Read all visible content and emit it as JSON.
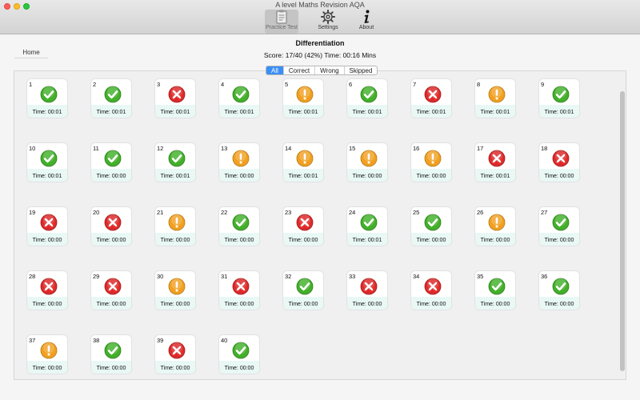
{
  "window": {
    "title": "A level Maths Revision AQA"
  },
  "toolbar": {
    "practice_label": "Practice Test",
    "settings_label": "Settings",
    "about_label": "About"
  },
  "nav": {
    "home_label": "Home"
  },
  "header": {
    "topic": "Differentiation",
    "score": "Score: 17/40 (42%) Time: 00:16 Mins"
  },
  "filters": [
    "All",
    "Correct",
    "Wrong",
    "Skipped"
  ],
  "filter_selected": "All",
  "colors": {
    "correct": "#43b02a",
    "wrong": "#e02a2a",
    "skipped": "#f0a020",
    "accent": "#3a8ff4"
  },
  "questions": [
    {
      "n": "1",
      "status": "correct",
      "time": "Time: 00:01"
    },
    {
      "n": "2",
      "status": "correct",
      "time": "Time: 00:01"
    },
    {
      "n": "3",
      "status": "wrong",
      "time": "Time: 00:01"
    },
    {
      "n": "4",
      "status": "correct",
      "time": "Time: 00:01"
    },
    {
      "n": "5",
      "status": "skipped",
      "time": "Time: 00:01"
    },
    {
      "n": "6",
      "status": "correct",
      "time": "Time: 00:01"
    },
    {
      "n": "7",
      "status": "wrong",
      "time": "Time: 00:01"
    },
    {
      "n": "8",
      "status": "skipped",
      "time": "Time: 00:01"
    },
    {
      "n": "9",
      "status": "correct",
      "time": "Time: 00:01"
    },
    {
      "n": "10",
      "status": "correct",
      "time": "Time: 00:01"
    },
    {
      "n": "11",
      "status": "correct",
      "time": "Time: 00:00"
    },
    {
      "n": "12",
      "status": "correct",
      "time": "Time: 00:01"
    },
    {
      "n": "13",
      "status": "skipped",
      "time": "Time: 00:00"
    },
    {
      "n": "14",
      "status": "skipped",
      "time": "Time: 00:01"
    },
    {
      "n": "15",
      "status": "skipped",
      "time": "Time: 00:00"
    },
    {
      "n": "16",
      "status": "skipped",
      "time": "Time: 00:00"
    },
    {
      "n": "17",
      "status": "wrong",
      "time": "Time: 00:01"
    },
    {
      "n": "18",
      "status": "wrong",
      "time": "Time: 00:00"
    },
    {
      "n": "19",
      "status": "wrong",
      "time": "Time: 00:00"
    },
    {
      "n": "20",
      "status": "wrong",
      "time": "Time: 00:00"
    },
    {
      "n": "21",
      "status": "skipped",
      "time": "Time: 00:00"
    },
    {
      "n": "22",
      "status": "correct",
      "time": "Time: 00:00"
    },
    {
      "n": "23",
      "status": "wrong",
      "time": "Time: 00:00"
    },
    {
      "n": "24",
      "status": "correct",
      "time": "Time: 00:01"
    },
    {
      "n": "25",
      "status": "correct",
      "time": "Time: 00:00"
    },
    {
      "n": "26",
      "status": "skipped",
      "time": "Time: 00:00"
    },
    {
      "n": "27",
      "status": "correct",
      "time": "Time: 00:00"
    },
    {
      "n": "28",
      "status": "wrong",
      "time": "Time: 00:00"
    },
    {
      "n": "29",
      "status": "wrong",
      "time": "Time: 00:00"
    },
    {
      "n": "30",
      "status": "skipped",
      "time": "Time: 00:00"
    },
    {
      "n": "31",
      "status": "wrong",
      "time": "Time: 00:00"
    },
    {
      "n": "32",
      "status": "correct",
      "time": "Time: 00:00"
    },
    {
      "n": "33",
      "status": "wrong",
      "time": "Time: 00:00"
    },
    {
      "n": "34",
      "status": "wrong",
      "time": "Time: 00:00"
    },
    {
      "n": "35",
      "status": "correct",
      "time": "Time: 00:00"
    },
    {
      "n": "36",
      "status": "correct",
      "time": "Time: 00:00"
    },
    {
      "n": "37",
      "status": "skipped",
      "time": "Time: 00:00"
    },
    {
      "n": "38",
      "status": "correct",
      "time": "Time: 00:00"
    },
    {
      "n": "39",
      "status": "wrong",
      "time": "Time: 00:00"
    },
    {
      "n": "40",
      "status": "correct",
      "time": "Time: 00:00"
    }
  ]
}
